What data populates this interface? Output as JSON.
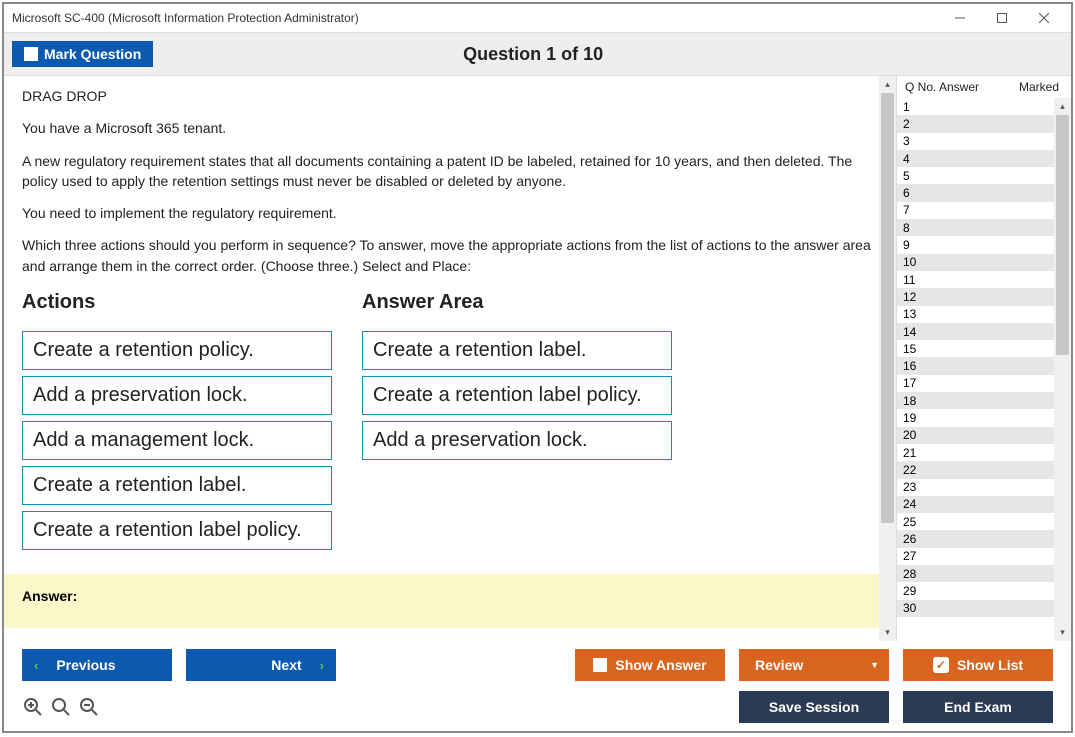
{
  "window": {
    "title": "Microsoft SC-400 (Microsoft Information Protection Administrator)"
  },
  "toolbar": {
    "mark_label": "Mark Question",
    "counter": "Question 1 of 10"
  },
  "question": {
    "type_label": "DRAG DROP",
    "p1": "You have a Microsoft 365 tenant.",
    "p2": "A new regulatory requirement states that all documents containing a patent ID be labeled, retained for 10 years, and then deleted. The policy used to apply the retention settings must never be disabled or deleted by anyone.",
    "p3": "You need to implement the regulatory requirement.",
    "p4": "Which three actions should you perform in sequence? To answer, move the appropriate actions from the list of actions to the answer area and arrange them in the correct order. (Choose three.) Select and Place:",
    "actions_heading": "Actions",
    "answer_heading": "Answer Area",
    "actions": [
      "Create a retention policy.",
      "Add a preservation lock.",
      "Add a management lock.",
      "Create a retention label.",
      "Create a retention label policy."
    ],
    "answers": [
      "Create a retention label.",
      "Create a retention label policy.",
      "Add a preservation lock."
    ],
    "answer_label": "Answer:"
  },
  "side": {
    "col_qno": "Q No.",
    "col_answer": "Answer",
    "col_marked": "Marked",
    "rows": 30
  },
  "footer": {
    "previous": "Previous",
    "next": "Next",
    "show_answer": "Show Answer",
    "review": "Review",
    "show_list": "Show List",
    "save_session": "Save Session",
    "end_exam": "End Exam"
  }
}
